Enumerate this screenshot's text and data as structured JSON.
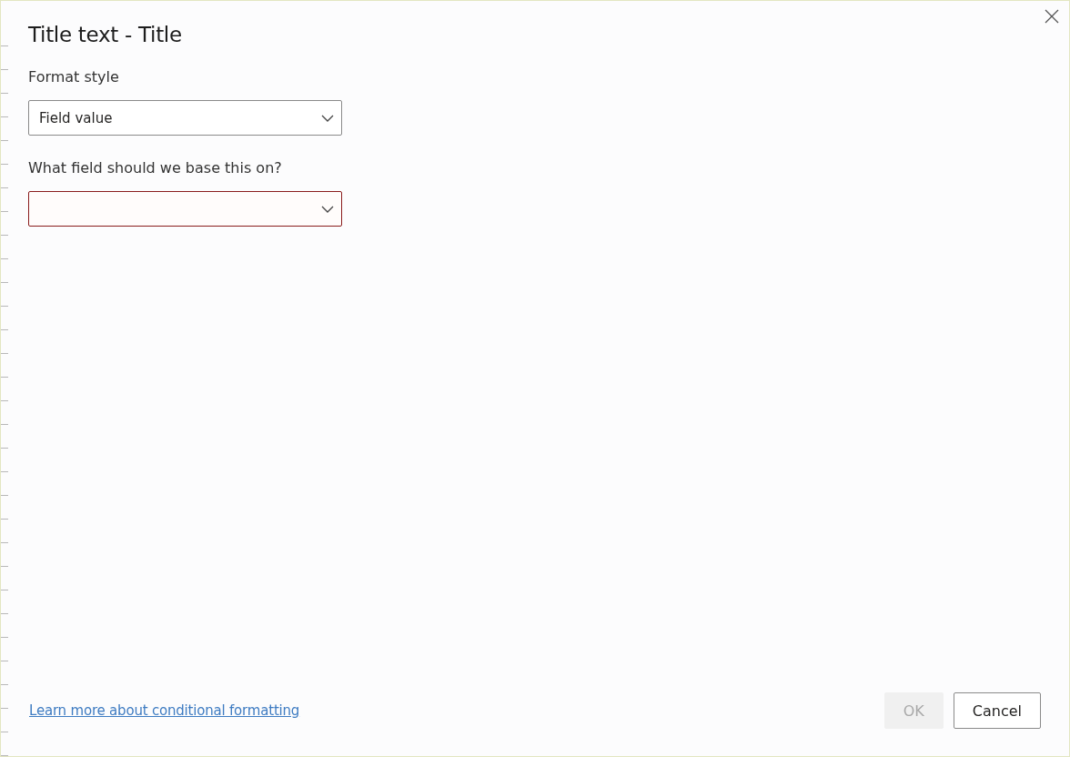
{
  "dialog": {
    "title": "Title text - Title",
    "fields": [
      {
        "label": "Format style",
        "value": "Field value",
        "invalid": false
      },
      {
        "label": "What field should we base this on?",
        "invalid": true
      }
    ],
    "link": "Learn more about conditional formatting",
    "buttons": [
      {
        "label": "OK",
        "disabled": true
      },
      {
        "label": "Cancel",
        "disabled": false
      }
    ]
  }
}
